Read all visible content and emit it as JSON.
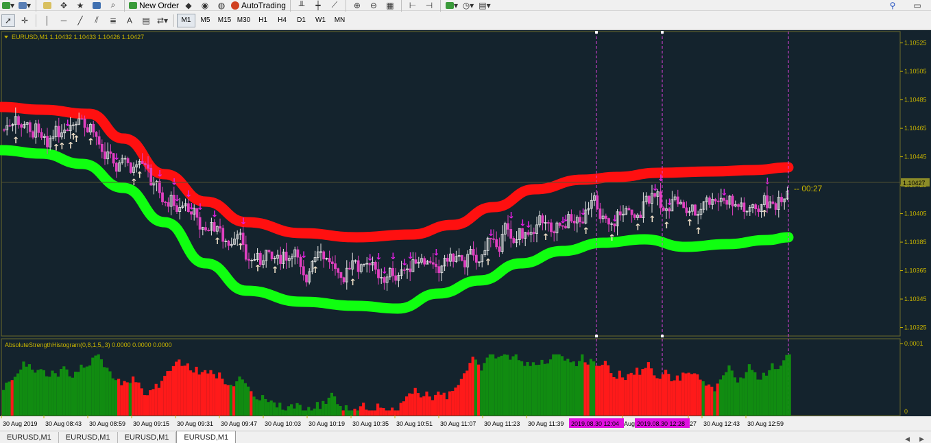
{
  "toolbar": {
    "new_order_label": "New Order",
    "autotrading_label": "AutoTrading"
  },
  "timeframes": [
    "M1",
    "M5",
    "M15",
    "M30",
    "H1",
    "H4",
    "D1",
    "W1",
    "MN"
  ],
  "active_timeframe": "M1",
  "chart": {
    "header": "EURUSD,M1  1.10432 1.10433 1.10426 1.10427",
    "current_price_label": "1.10427",
    "countdown": "-- 00:27",
    "indicator_header": "AbsoluteStrengthHistogram(0,8,1,5,,3) 0.0000 0.0000 0.0000",
    "indicator_scale_top": "0.0001",
    "indicator_scale_bottom": "0",
    "price_ticks": [
      "1.10525",
      "1.10505",
      "1.10485",
      "1.10465",
      "1.10445",
      "1.10425",
      "1.10405",
      "1.10385",
      "1.10365",
      "1.10345",
      "1.10325"
    ],
    "time_ticks": [
      "30 Aug 2019",
      "30 Aug 08:43",
      "30 Aug 08:59",
      "30 Aug 09:15",
      "30 Aug 09:31",
      "30 Aug 09:47",
      "30 Aug 10:03",
      "30 Aug 10:19",
      "30 Aug 10:35",
      "30 Aug 10:51",
      "30 Aug 11:07",
      "30 Aug 11:23",
      "30 Aug 11:39",
      "Aug",
      "27",
      "30 Aug 12:43",
      "30 Aug 12:59"
    ],
    "vline_labels": [
      "2019.08.30 12:04",
      "2019.08.30 12:28"
    ],
    "colors": {
      "background": "#14232d",
      "upper_band": "#ff1010",
      "lower_band": "#10ff10",
      "arrow_down": "#e020e0",
      "arrow_up": "#f0e0c8",
      "hist_up": "#118c11",
      "hist_down": "#ff1a1a",
      "axis_text": "#c8b400",
      "price_tag": "#8c8c28"
    }
  },
  "tabs": [
    "EURUSD,M1",
    "EURUSD,M1",
    "EURUSD,M1",
    "EURUSD,M1"
  ],
  "active_tab": 3
}
